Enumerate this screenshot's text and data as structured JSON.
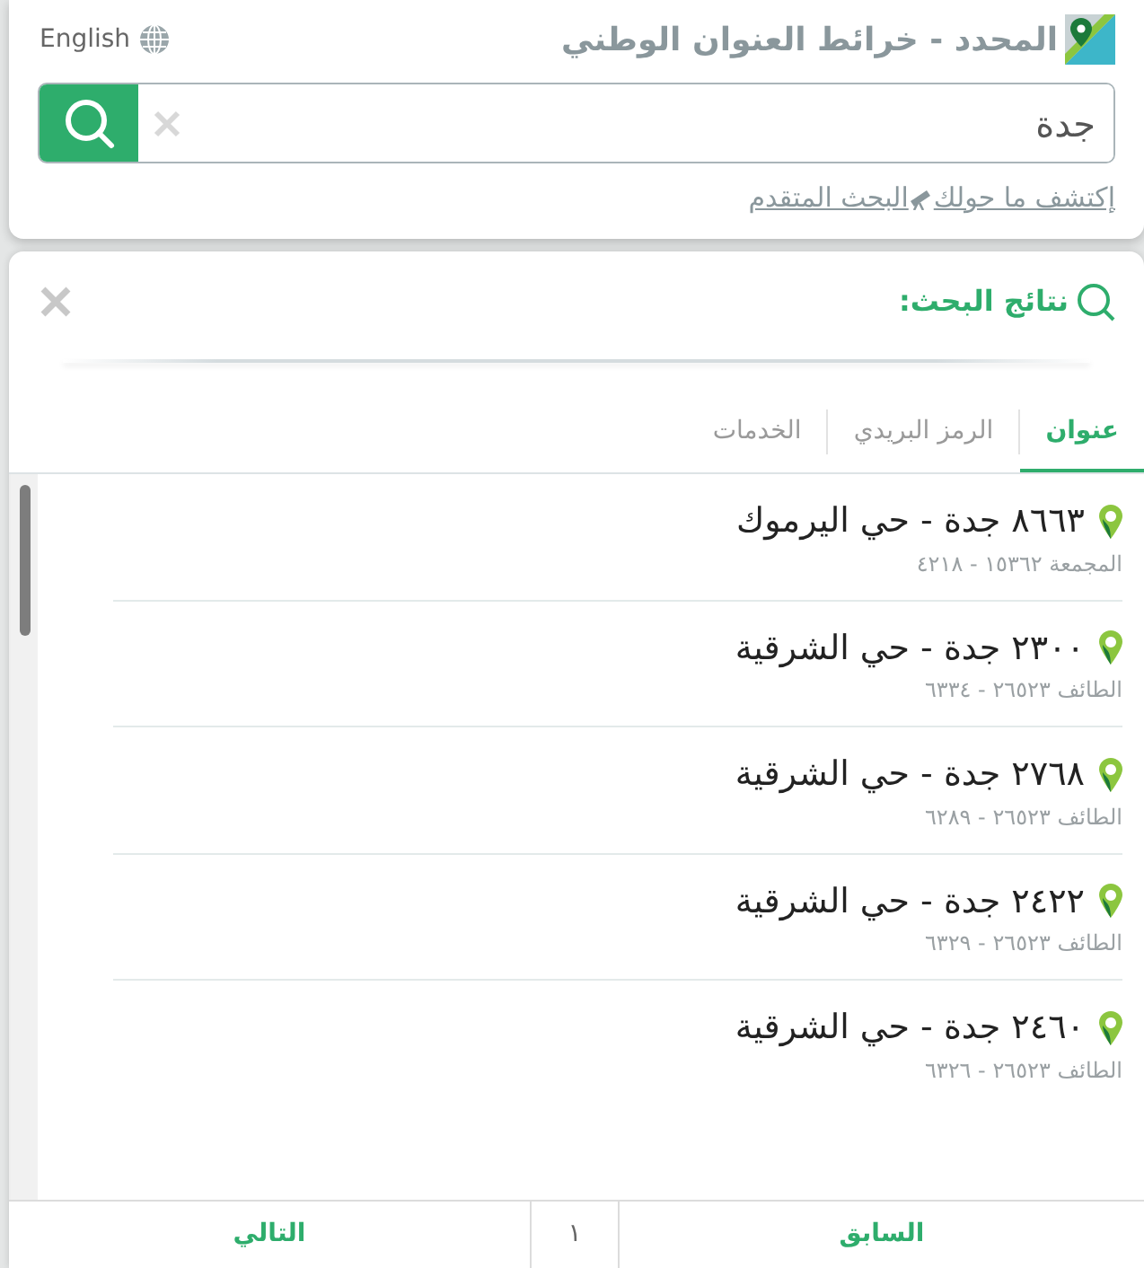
{
  "header": {
    "title": "المحدد - خرائط العنوان الوطني",
    "language": "English"
  },
  "search": {
    "value": "جدة"
  },
  "links": [
    "إكتشف ما حولك",
    "البحث المتقدم"
  ],
  "results": {
    "title": "نتائج البحث:",
    "tabs": [
      {
        "label": "عنوان",
        "selected": true
      },
      {
        "label": "الرمز البريدي",
        "selected": false
      },
      {
        "label": "الخدمات",
        "selected": false
      }
    ],
    "items": [
      {
        "title": "٨٦٦٣ جدة - حي اليرموك",
        "subtitle": "المجمعة ١٥٣٦٢ - ٤٢١٨"
      },
      {
        "title": "٢٣٠٠ جدة - حي الشرقية",
        "subtitle": "الطائف ٢٦٥٢٣ - ٦٣٣٤"
      },
      {
        "title": "٢٧٦٨ جدة - حي الشرقية",
        "subtitle": "الطائف ٢٦٥٢٣ - ٦٢٨٩"
      },
      {
        "title": "٢٤٢٢ جدة - حي الشرقية",
        "subtitle": "الطائف ٢٦٥٢٣ - ٦٣٢٩"
      },
      {
        "title": "٢٤٦٠ جدة - حي الشرقية",
        "subtitle": "الطائف ٢٦٥٢٣ - ٦٣٢٦"
      }
    ],
    "pagination": {
      "previous": "السابق",
      "page": "١",
      "next": "التالي"
    }
  }
}
